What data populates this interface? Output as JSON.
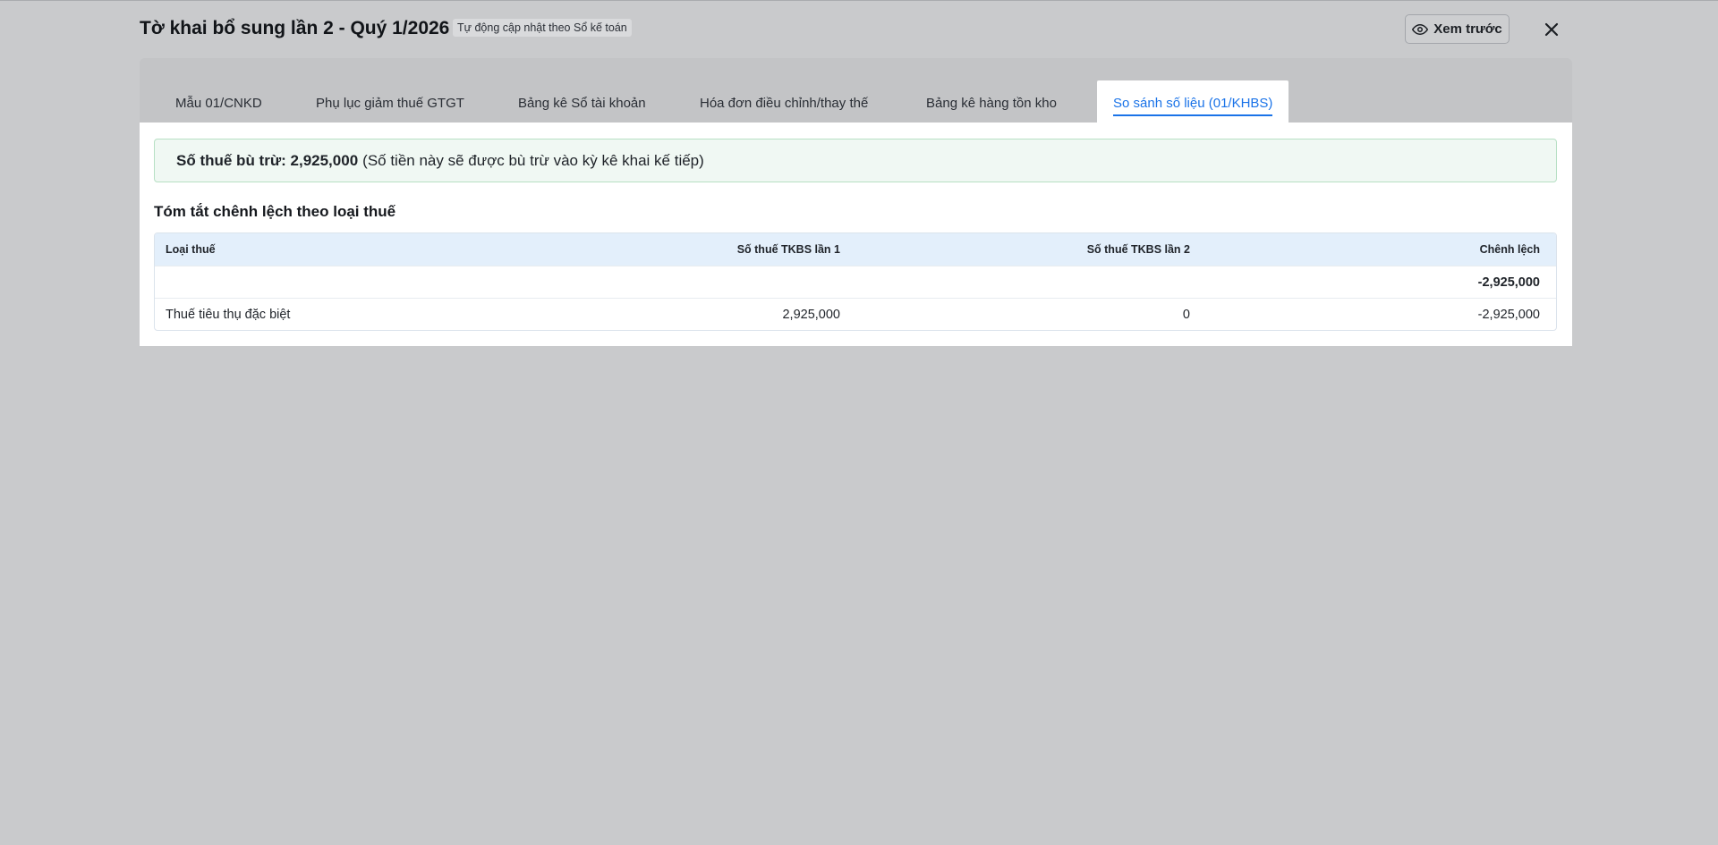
{
  "header": {
    "title": "Tờ khai bổ sung lần 2 - Quý 1/2026",
    "badge": "Tự động cập nhật theo Sổ kế toán",
    "preview_label": "Xem trước",
    "preview_icon": "eye-icon",
    "close_icon": "close-icon"
  },
  "tabs": [
    {
      "label": "Mẫu 01/CNKD",
      "active": false
    },
    {
      "label": "Phụ lục giảm thuế GTGT",
      "active": false
    },
    {
      "label": "Bảng kê Sổ tài khoản",
      "active": false
    },
    {
      "label": "Hóa đơn điều chỉnh/thay thế",
      "active": false
    },
    {
      "label": "Bảng kê hàng tồn kho",
      "active": false
    },
    {
      "label": "So sánh số liệu (01/KHBS)",
      "active": true
    }
  ],
  "alert": {
    "label": "Số thuế bù trừ: 2,925,000",
    "note": "(Số tiền này sẽ được bù trừ vào kỳ kê khai kế tiếp)"
  },
  "summary": {
    "title": "Tóm tắt chênh lệch theo loại thuế",
    "columns": [
      "Loại thuế",
      "Số thuế TKBS lần 1",
      "Số thuế TKBS lần 2",
      "Chênh lệch"
    ],
    "total_row": [
      "",
      "",
      "",
      "-2,925,000"
    ],
    "rows": [
      [
        "Thuế tiêu thụ đặc biệt",
        "2,925,000",
        "0",
        "-2,925,000"
      ]
    ]
  },
  "colors": {
    "accent": "#1a73e8",
    "overlay": "#c9cacc",
    "alert_bg": "#f0f8f3",
    "table_head_bg": "#e3effb"
  }
}
